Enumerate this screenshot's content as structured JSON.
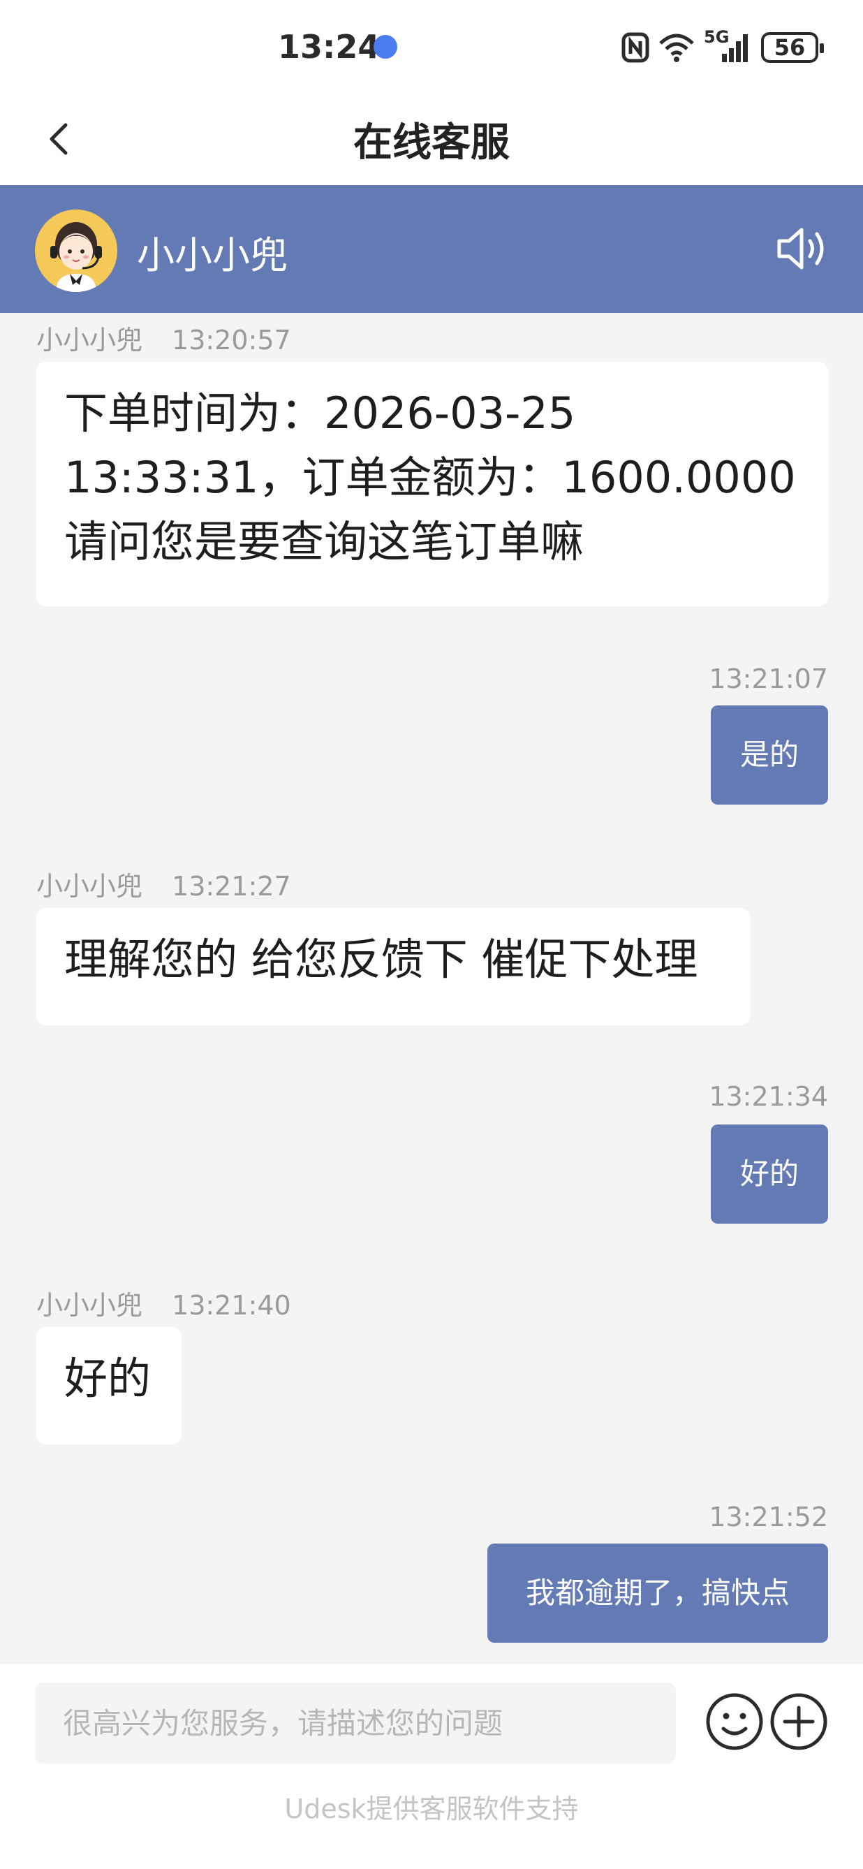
{
  "status_bar": {
    "time": "13:24",
    "network": "5G",
    "battery": "56"
  },
  "header": {
    "title": "在线客服",
    "back_icon": "chevron-left-icon"
  },
  "agent": {
    "name": "小小小兜",
    "avatar_icon": "agent-avatar-icon",
    "sound_icon": "speaker-icon"
  },
  "messages": [
    {
      "direction": "incoming",
      "sender": "小小小兜",
      "time": "13:20:57",
      "lines": [
        "下单时间为：2026-03-25",
        "13:33:31，订单金额为：1600.0000",
        "请问您是要查询这笔订单嘛"
      ]
    },
    {
      "direction": "outgoing",
      "time": "13:21:07",
      "text": "是的"
    },
    {
      "direction": "incoming",
      "sender": "小小小兜",
      "time": "13:21:27",
      "lines": [
        "理解您的 给您反馈下 催促下处理"
      ]
    },
    {
      "direction": "outgoing",
      "time": "13:21:34",
      "text": "好的"
    },
    {
      "direction": "incoming",
      "sender": "小小小兜",
      "time": "13:21:40",
      "lines": [
        "好的"
      ]
    },
    {
      "direction": "outgoing",
      "time": "13:21:52",
      "text": "我都逾期了，搞快点"
    }
  ],
  "composer": {
    "placeholder": "很高兴为您服务，请描述您的问题",
    "value": "",
    "emoji_icon": "emoji-icon",
    "plus_icon": "plus-icon"
  },
  "footer": {
    "note": "Udesk提供客服软件支持"
  },
  "colors": {
    "accent": "#647ab4",
    "background": "#f4f4f5",
    "bubble_incoming": "#ffffff"
  }
}
